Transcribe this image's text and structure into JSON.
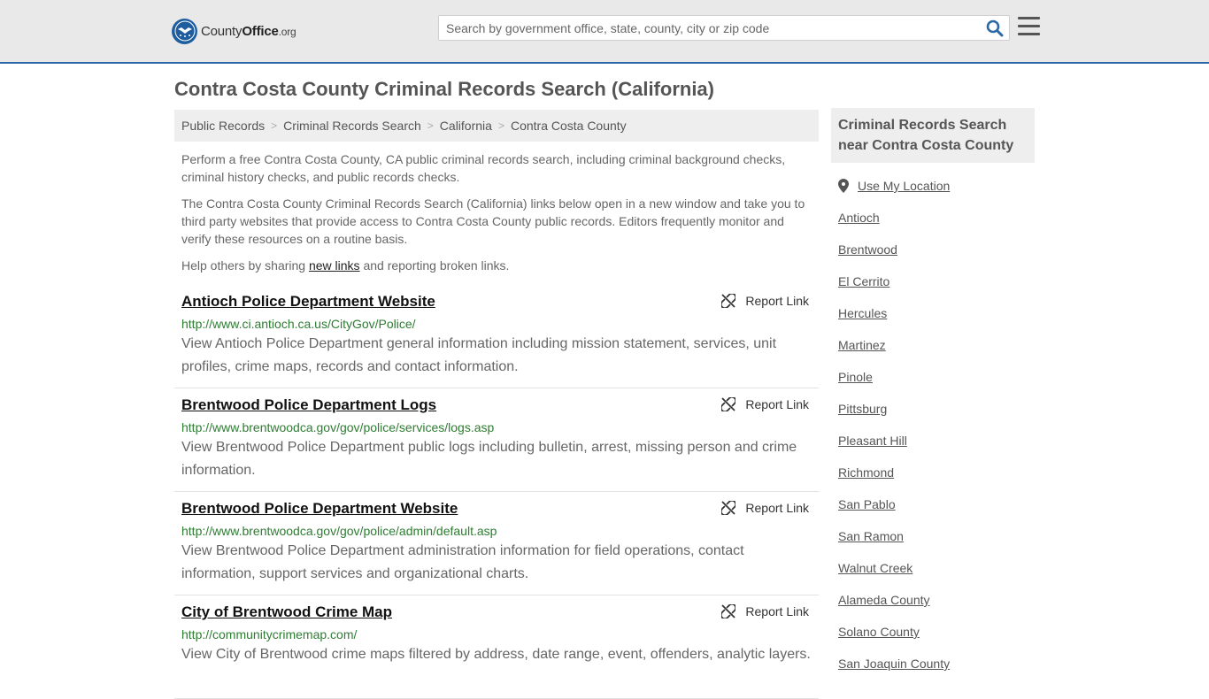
{
  "header": {
    "logo_brand_plain": "County",
    "logo_brand_bold": "Office",
    "logo_brand_tld": ".org",
    "search_placeholder": "Search by government office, state, county, city or zip code",
    "search_icon": "search-icon",
    "menu_icon": "hamburger-menu-icon",
    "accent_color": "#2a68a8"
  },
  "page": {
    "title": "Contra Costa County Criminal Records Search (California)"
  },
  "breadcrumb": [
    {
      "label": "Public Records"
    },
    {
      "label": "Criminal Records Search"
    },
    {
      "label": "California"
    },
    {
      "label": "Contra Costa County"
    }
  ],
  "intro": {
    "p1": "Perform a free Contra Costa County, CA public criminal records search, including criminal background checks, criminal history checks, and public records checks.",
    "p2": "The Contra Costa County Criminal Records Search (California) links below open in a new window and take you to third party websites that provide access to Contra Costa County public records. Editors frequently monitor and verify these resources on a routine basis.",
    "p3_before": "Help others by sharing ",
    "p3_link": "new links",
    "p3_after": " and reporting broken links."
  },
  "report_label": "Report Link",
  "listings": [
    {
      "title": "Antioch Police Department Website",
      "url": "http://www.ci.antioch.ca.us/CityGov/Police/",
      "desc": "View Antioch Police Department general information including mission statement, services, unit profiles, crime maps, records and contact information."
    },
    {
      "title": "Brentwood Police Department Logs",
      "url": "http://www.brentwoodca.gov/gov/police/services/logs.asp",
      "desc": "View Brentwood Police Department public logs including bulletin, arrest, missing person and crime information."
    },
    {
      "title": "Brentwood Police Department Website",
      "url": "http://www.brentwoodca.gov/gov/police/admin/default.asp",
      "desc": "View Brentwood Police Department administration information for field operations, contact information, support services and organizational charts."
    },
    {
      "title": "City of Brentwood Crime Map",
      "url": "http://communitycrimemap.com/",
      "desc": "View City of Brentwood crime maps filtered by address, date range, event, offenders, analytic layers."
    }
  ],
  "sidebar": {
    "heading": "Criminal Records Search near Contra Costa County",
    "use_location": "Use My Location",
    "items": [
      "Antioch",
      "Brentwood",
      "El Cerrito",
      "Hercules",
      "Martinez",
      "Pinole",
      "Pittsburg",
      "Pleasant Hill",
      "Richmond",
      "San Pablo",
      "San Ramon",
      "Walnut Creek",
      "Alameda County",
      "Solano County",
      "San Joaquin County"
    ]
  }
}
